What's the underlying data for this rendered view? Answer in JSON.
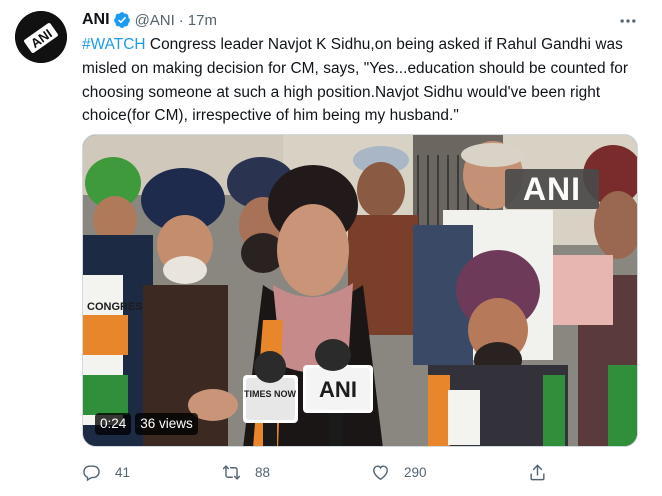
{
  "tweet": {
    "author_name": "ANI",
    "handle": "@ANI",
    "separator": "·",
    "time": "17m",
    "hashtag": "#WATCH",
    "body": " Congress leader Navjot K Sidhu,on being asked if Rahul Gandhi was misled on making decision for CM, says, \"Yes...education should be counted for choosing someone at such a high position.Navjot Sidhu would've been right choice(for CM), irrespective of him being my husband.\"",
    "avatar_label": "ANI",
    "verified_color": "#1d9bf0"
  },
  "media": {
    "watermark": "ANI",
    "duration": "0:24",
    "views": "36 views",
    "mic_label_1": "TIMES NOW",
    "mic_label_2": "ANI",
    "scarf_text": "CONGRESS"
  },
  "actions": {
    "replies": "41",
    "retweets": "88",
    "likes": "290"
  }
}
